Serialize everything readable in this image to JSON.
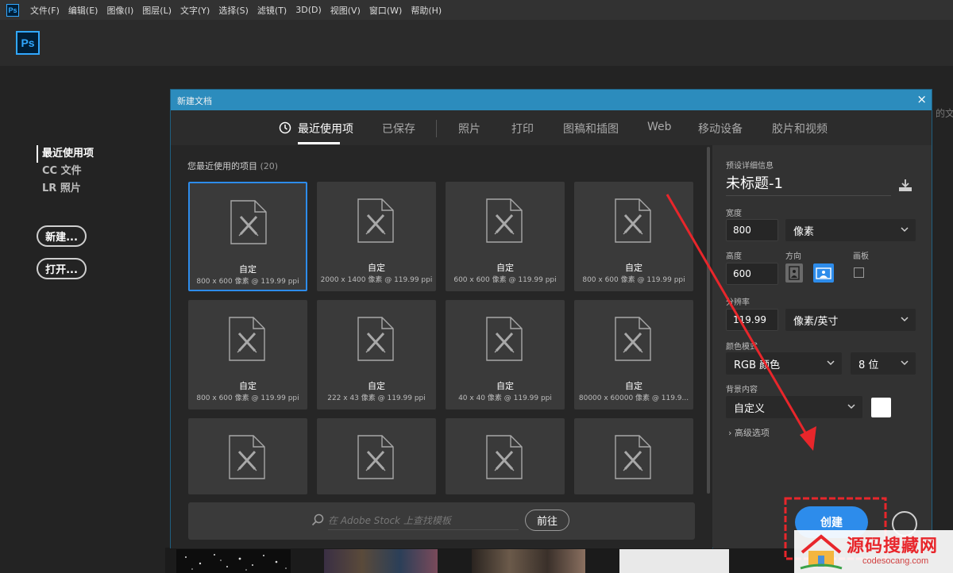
{
  "menubar": {
    "logo": "Ps",
    "items": [
      "文件(F)",
      "编辑(E)",
      "图像(I)",
      "图层(L)",
      "文字(Y)",
      "选择(S)",
      "滤镜(T)",
      "3D(D)",
      "视图(V)",
      "窗口(W)",
      "帮助(H)"
    ]
  },
  "home": {
    "logo": "Ps",
    "nav": [
      "最近使用项",
      "CC 文件",
      "LR 照片"
    ],
    "new_button": "新建...",
    "open_button": "打开...",
    "edge_text": "的文"
  },
  "dialog": {
    "title": "新建文档",
    "close": "×",
    "tabs": [
      "最近使用项",
      "已保存",
      "照片",
      "打印",
      "图稿和插图",
      "Web",
      "移动设备",
      "胶片和视频"
    ],
    "section_label": "您最近使用的项目",
    "section_count": "(20)",
    "items": [
      {
        "title": "自定",
        "sub": "800 x 600 像素 @ 119.99 ppi"
      },
      {
        "title": "自定",
        "sub": "2000 x 1400 像素 @ 119.99 ppi"
      },
      {
        "title": "自定",
        "sub": "600 x 600 像素 @ 119.99 ppi"
      },
      {
        "title": "自定",
        "sub": "800 x 600 像素 @ 119.99 ppi"
      },
      {
        "title": "自定",
        "sub": "800 x 600 像素 @ 119.99 ppi"
      },
      {
        "title": "自定",
        "sub": "222 x 43 像素 @ 119.99 ppi"
      },
      {
        "title": "自定",
        "sub": "40 x 40 像素 @ 119.99 ppi"
      },
      {
        "title": "自定",
        "sub": "80000 x 60000 像素 @ 119.9..."
      }
    ],
    "search": {
      "placeholder": "在 Adobe Stock 上查找模板",
      "go": "前往"
    }
  },
  "preset": {
    "header": "预设详细信息",
    "name": "未标题-1",
    "width_label": "宽度",
    "width_value": "800",
    "width_unit": "像素",
    "height_label": "高度",
    "height_value": "600",
    "orientation_label": "方向",
    "artboard_label": "画板",
    "resolution_label": "分辨率",
    "resolution_value": "119.99",
    "resolution_unit": "像素/英寸",
    "color_mode_label": "颜色模式",
    "color_mode": "RGB 颜色",
    "bit_depth": "8 位",
    "background_label": "背景内容",
    "background": "自定义",
    "advanced": "高级选项",
    "create": "创建"
  },
  "watermark": {
    "cn": "源码搜藏网",
    "en": "codesocang.com"
  },
  "colors": {
    "accent": "#2d8ceb",
    "titlebar": "#2c8cbd",
    "annotation": "#e8262b"
  }
}
